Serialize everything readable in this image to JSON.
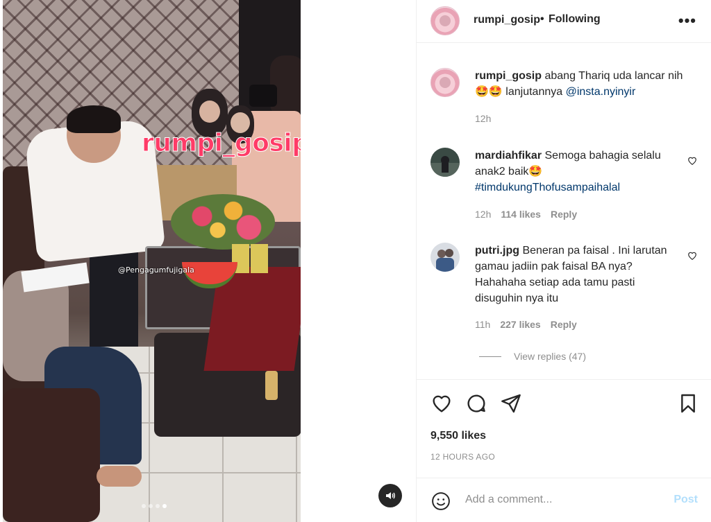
{
  "media": {
    "overlay_text": "rumpi_gosip",
    "overlay_watermark": "@Pengagumfujigala",
    "carousel_dots": 4,
    "active_dot": 4
  },
  "header": {
    "username": "rumpi_gosip",
    "separator": "•",
    "follow_status": "Following",
    "more_icon": "more-icon"
  },
  "caption": {
    "username": "rumpi_gosip",
    "text": "abang Thariq uda lancar nih🤩🤩 lanjutannya ",
    "mention": "@insta.nyinyir",
    "age": "12h"
  },
  "comments": [
    {
      "username": "mardiahfikar",
      "text": "Semoga bahagia selalu anak2 baik🤩 ",
      "hashtag": "#timdukungThofusampaihalal",
      "age": "12h",
      "likes": "114 likes",
      "reply": "Reply"
    },
    {
      "username": "putri.jpg",
      "text": "Beneran pa faisal . Ini larutan gamau jadiin pak faisal BA nya? Hahahaha setiap ada tamu pasti disuguhin nya itu",
      "age": "11h",
      "likes": "227 likes",
      "reply": "Reply"
    }
  ],
  "view_replies": "View replies (47)",
  "actions": {
    "likes": "9,550 likes",
    "timestamp": "12 HOURS AGO"
  },
  "add_comment": {
    "placeholder": "Add a comment...",
    "post_label": "Post"
  },
  "colors": {
    "link": "#00376b",
    "muted": "#8e8e8e",
    "post_disabled": "#b2dffc",
    "overlay_pink": "#ff3b67"
  }
}
